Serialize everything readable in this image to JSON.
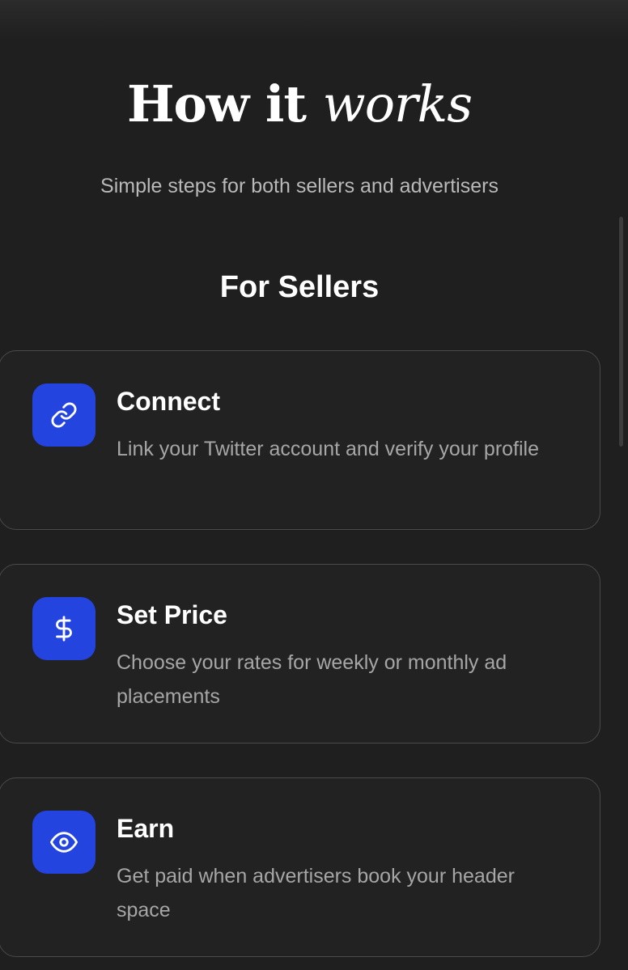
{
  "header": {
    "title_plain": "How it",
    "title_emphasis": "works",
    "subtitle": "Simple steps for both sellers and advertisers"
  },
  "section": {
    "title": "For Sellers"
  },
  "steps": [
    {
      "icon": "link-icon",
      "title": "Connect",
      "description": "Link your Twitter account and verify your profile"
    },
    {
      "icon": "dollar-icon",
      "title": "Set Price",
      "description": "Choose your rates for weekly or monthly ad placements"
    },
    {
      "icon": "eye-icon",
      "title": "Earn",
      "description": "Get paid when advertisers book your header space"
    }
  ],
  "colors": {
    "background": "#1f1f1f",
    "card_background": "#222222",
    "card_border": "#4a4a4a",
    "accent_blue": "#2444e0",
    "muted_text": "#a6a6a6"
  }
}
